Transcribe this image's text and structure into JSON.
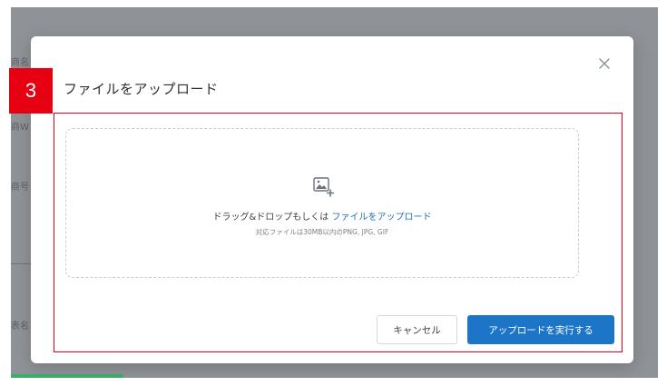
{
  "background": {
    "labels": [
      "商名",
      "商W",
      "商号",
      "—",
      "表名"
    ]
  },
  "step": {
    "number": "3",
    "color": "#e60012"
  },
  "dialog": {
    "title": "ファイルをアップロード",
    "close_icon": "close-icon",
    "dropzone": {
      "icon": "image-add-icon",
      "prompt_prefix": "ドラッグ&ドロップもしくは",
      "prompt_link": "ファイルをアップロード",
      "formats_note": "対応ファイルは30MB以内のPNG, JPG, GIF"
    },
    "buttons": {
      "cancel_label": "キャンセル",
      "submit_label": "アップロードを実行する"
    },
    "accent_color": "#1c75c6"
  }
}
